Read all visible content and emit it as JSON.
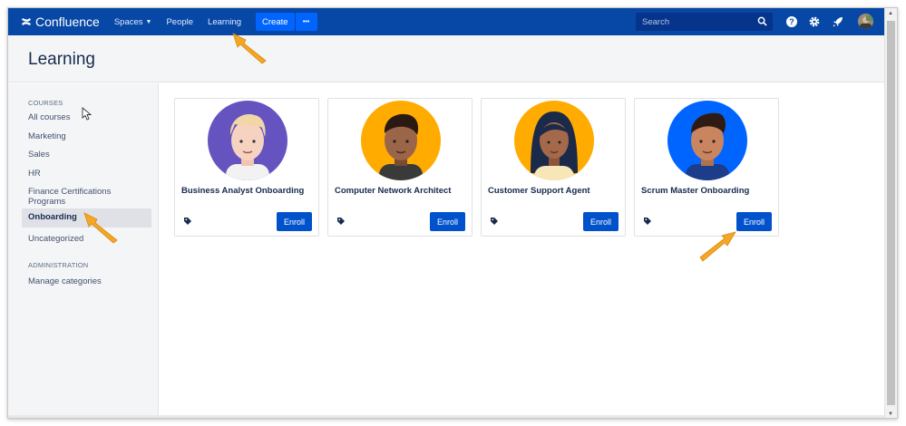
{
  "nav": {
    "brand": "Confluence",
    "spaces": "Spaces",
    "people": "People",
    "learning": "Learning",
    "create": "Create",
    "more": "•••",
    "search_placeholder": "Search"
  },
  "page": {
    "title": "Learning"
  },
  "sidebar": {
    "courses_heading": "COURSES",
    "items": [
      {
        "label": "All courses"
      },
      {
        "label": "Marketing"
      },
      {
        "label": "Sales"
      },
      {
        "label": "HR"
      },
      {
        "label": "Finance Certifications Programs"
      },
      {
        "label": "Onboarding",
        "active": true
      },
      {
        "label": "Uncategorized"
      }
    ],
    "admin_heading": "ADMINISTRATION",
    "admin_items": [
      {
        "label": "Manage categories"
      }
    ]
  },
  "cards": [
    {
      "title": "Business Analyst Onboarding",
      "button": "Enroll",
      "bg": "#6554c0"
    },
    {
      "title": "Computer Network Architect",
      "button": "Enroll",
      "bg": "#ffab00"
    },
    {
      "title": "Customer Support Agent",
      "button": "Enroll",
      "bg": "#ffab00"
    },
    {
      "title": "Scrum Master Onboarding",
      "button": "Enroll",
      "bg": "#0065ff"
    }
  ],
  "colors": {
    "nav_bg": "#0747a6",
    "primary_button": "#0052cc",
    "annotation_arrow": "#f5a623"
  }
}
